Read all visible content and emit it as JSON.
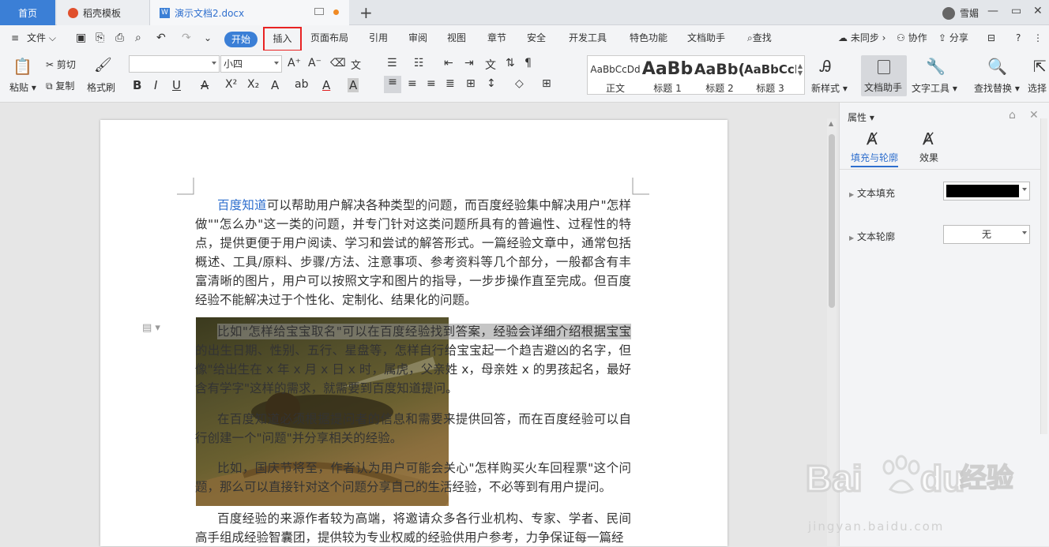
{
  "tabbar": {
    "home": "首页",
    "template": "稻壳模板",
    "doc": "演示文档2.docx",
    "user": "雪媚"
  },
  "menubar": {
    "file": "文件",
    "start": "开始",
    "insert": "插入",
    "items": [
      "页面布局",
      "引用",
      "审阅",
      "视图",
      "章节",
      "安全",
      "开发工具",
      "特色功能",
      "文档助手"
    ],
    "search": "查找",
    "sync": "未同步",
    "collab": "协作",
    "share": "分享"
  },
  "ribbon": {
    "paste": "粘贴",
    "cut": "剪切",
    "copy": "复制",
    "format_painter": "格式刷",
    "font_size": "小四",
    "styles": [
      {
        "preview": "AaBbCcDd",
        "name": "正文"
      },
      {
        "preview": "AaBb",
        "name": "标题 1"
      },
      {
        "preview": "AaBb(",
        "name": "标题 2"
      },
      {
        "preview": "AaBbCcI",
        "name": "标题 3"
      }
    ],
    "new_style": "新样式",
    "doc_assistant": "文档助手",
    "text_tools": "文字工具",
    "find_replace": "查找替换",
    "select": "选择"
  },
  "document": {
    "p1_link": "百度知道",
    "p1": "可以帮助用户解决各种类型的问题，而百度经验集中解决用户\"怎样做\"\"怎么办\"这一类的问题，并专门针对这类问题所具有的普遍性、过程性的特点，提供更便于用户阅读、学习和尝试的解答形式。一篇经验文章中，通常包括概述、工具/原料、步骤/方法、注意事项、参考资料等几个部分，一般都含有丰富清晰的图片，用户可以按照文字和图片的指导，一步步操作直至完成。但百度经验不能解决过于个性化、定制化、结果化的问题。",
    "p2": "比如\"怎样给宝宝取名\"可以在百度经验找到答案，经验会详细介绍根据宝宝的出生日期、性别、五行、星盘等，怎样自行给宝宝起一个趋吉避凶的名字，但像\"给出生在 x 年 x 月 x 日 x 时，属虎，父亲姓 x，母亲姓 x 的男孩起名，最好含有学字\"这样的需求，就需要到百度知道提问。",
    "p3": "在百度知道必须根据提问者的信息和需要来提供回答，而在百度经验可以自行创建一个\"问题\"并分享相关的经验。",
    "p4": "比如，国庆节将至，作者认为用户可能会关心\"怎样购买火车回程票\"这个问题，那么可以直接针对这个问题分享自己的生活经验，不必等到有用户提问。",
    "p5": "百度经验的来源作者较为高端，将邀请众多各行业机构、专家、学者、民间高手组成经验智囊团，提供较为专业权威的经验供用户参考，力争保证每一篇经"
  },
  "panel": {
    "title": "属性",
    "tab_fill": "填充与轮廓",
    "tab_effect": "效果",
    "text_fill": "文本填充",
    "text_outline": "文本轮廓",
    "outline_value": "无",
    "fill_color": "#000000"
  },
  "watermark": {
    "text": "经验",
    "url": "jingyan.baidu.com"
  },
  "colors": {
    "accent": "#3b7fd6",
    "insert_highlight": "#e82323",
    "link": "#2f6fce"
  }
}
